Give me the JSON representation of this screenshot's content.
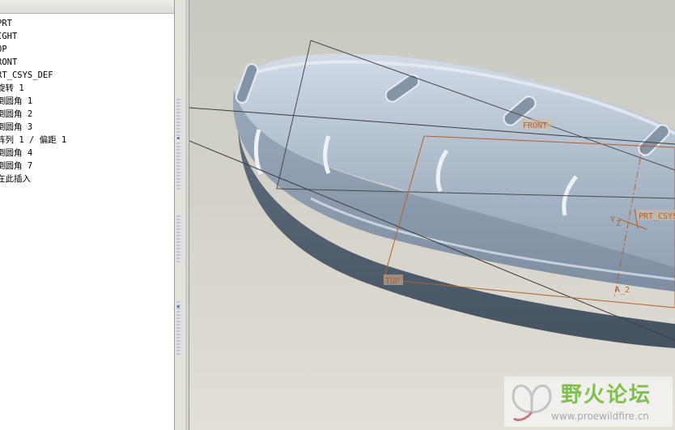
{
  "model_tree": {
    "items": [
      {
        "label": "PRT"
      },
      {
        "label": "IGHT"
      },
      {
        "label": "OP"
      },
      {
        "label": "RONT"
      },
      {
        "label": "RT_CSYS_DEF"
      },
      {
        "label": "旋转 1"
      },
      {
        "label": "倒圆角 1"
      },
      {
        "label": "倒圆角 2"
      },
      {
        "label": "倒圆角 3"
      },
      {
        "label": "阵列 1 / 偏距 1"
      },
      {
        "label": "倒圆角 4"
      },
      {
        "label": "倒圆角 7"
      },
      {
        "label": "在此插入"
      }
    ]
  },
  "viewport": {
    "datum_labels": {
      "front": "FRONT",
      "top": "TOP",
      "csys": "PRT_CSYS",
      "axis": "A_2",
      "axis_y": "Y",
      "axis_z": "Z"
    },
    "colors": {
      "background": "#d4d2c8",
      "part": "#a9b6c6",
      "datum": "#b0622a"
    }
  },
  "watermark": {
    "title": "野火论坛",
    "url": "www.proewildfire.cn"
  }
}
